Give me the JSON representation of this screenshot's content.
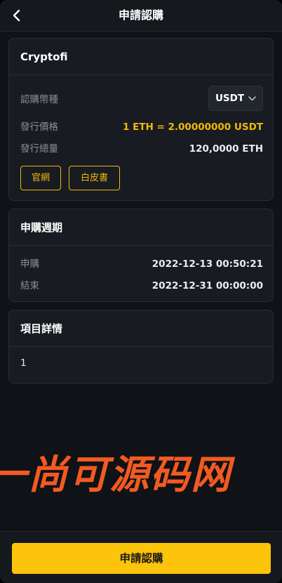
{
  "header": {
    "title": "申請認購",
    "back_icon": "chevron-left-icon"
  },
  "project_card": {
    "title": "Cryptofi",
    "currency_label": "認購幣種",
    "currency_value": "USDT",
    "price_label": "發行價格",
    "price_value": "1 ETH = 2.00000000 USDT",
    "total_label": "發行總量",
    "total_value": "120,0000 ETH",
    "website_button": "官網",
    "whitepaper_button": "白皮書"
  },
  "period_card": {
    "title": "申購週期",
    "start_label": "申購",
    "start_value": "2022-12-13 00:50:21",
    "end_label": "結束",
    "end_value": "2022-12-31 00:00:00"
  },
  "detail_card": {
    "title": "項目詳情",
    "content": "1"
  },
  "watermark": "一尚可源码网",
  "footer": {
    "submit_button": "申請認購"
  },
  "colors": {
    "accent": "#f0b90b",
    "button_fill": "#fcc40a",
    "background": "#0f1216",
    "card": "#181b21",
    "watermark": "#f25a22"
  }
}
